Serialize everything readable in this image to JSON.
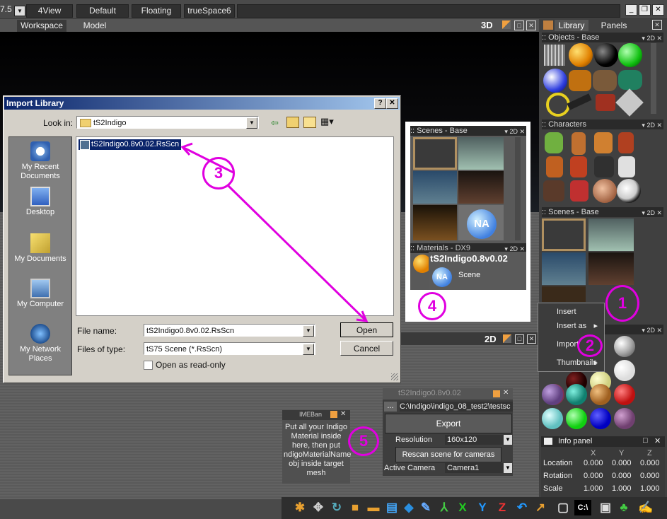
{
  "app": {
    "version_fragment": "7.5",
    "top_tabs": [
      "4View",
      "Default",
      "Floating",
      "trueSpace6"
    ],
    "workspace_tabs": [
      "Workspace",
      "Model"
    ],
    "view_mode": "3D",
    "view_mode_2d": "2D"
  },
  "dialog": {
    "title": "Import Library",
    "help_btn": "?",
    "close_btn": "✕",
    "look_in_label": "Look in:",
    "look_in_value": "tS2Indigo",
    "places": [
      "My Recent Documents",
      "Desktop",
      "My Documents",
      "My Computer",
      "My Network Places"
    ],
    "files": [
      "tS2Indigo0.8v0.02.RsScn"
    ],
    "file_name_label": "File name:",
    "file_name_value": "tS2Indigo0.8v0.02.RsScn",
    "files_of_type_label": "Files of type:",
    "files_of_type_value": "tS75 Scene (*.RsScn)",
    "read_only_label": "Open as read-only",
    "open_btn": "Open",
    "cancel_btn": "Cancel"
  },
  "library": {
    "tabs": [
      "Library",
      "Panels"
    ],
    "sections": [
      ":: Objects - Base",
      ":: Characters",
      ":: Scenes - Base"
    ],
    "badge_2d": "2D"
  },
  "scenes_float": {
    "header": ":: Scenes - Base",
    "materials_header": ":: Materials - DX9",
    "tooltip_title": "tS2Indigo0.8v0.02",
    "tooltip_sub": "Scene",
    "na_label": "NA"
  },
  "context_menu": {
    "items": [
      "Insert",
      "Insert as",
      "Import",
      "Thumbnails"
    ]
  },
  "info_panel": {
    "title": "Info panel",
    "axes": [
      "X",
      "Y",
      "Z"
    ],
    "rows": [
      {
        "label": "Location",
        "values": [
          "0.000",
          "0.000",
          "0.000"
        ]
      },
      {
        "label": "Rotation",
        "values": [
          "0.000",
          "0.000",
          "0.000"
        ]
      },
      {
        "label": "Scale",
        "values": [
          "1.000",
          "1.000",
          "1.000"
        ]
      }
    ]
  },
  "material_box": {
    "title": "IMEBan",
    "text": "Put all your Indigo Material inside here, then put ndigoMaterialName obj inside target mesh"
  },
  "export_panel": {
    "title": "tS2Indigo0.8v0.02",
    "path_btn": "...",
    "path": "C:\\Indigo\\indigo_08_test2\\testsc",
    "export_btn": "Export",
    "resolution_label": "Resolution",
    "resolution_value": "160x120",
    "rescan_btn": "Rescan scene for cameras",
    "camera_label": "Active Camera",
    "camera_value": "Camera1"
  },
  "annotations": [
    "1",
    "2",
    "3",
    "4",
    "5"
  ],
  "colors": {
    "annotation": "#e000e0",
    "dialog_title": "#0a246a",
    "selection": "#0a246a"
  }
}
